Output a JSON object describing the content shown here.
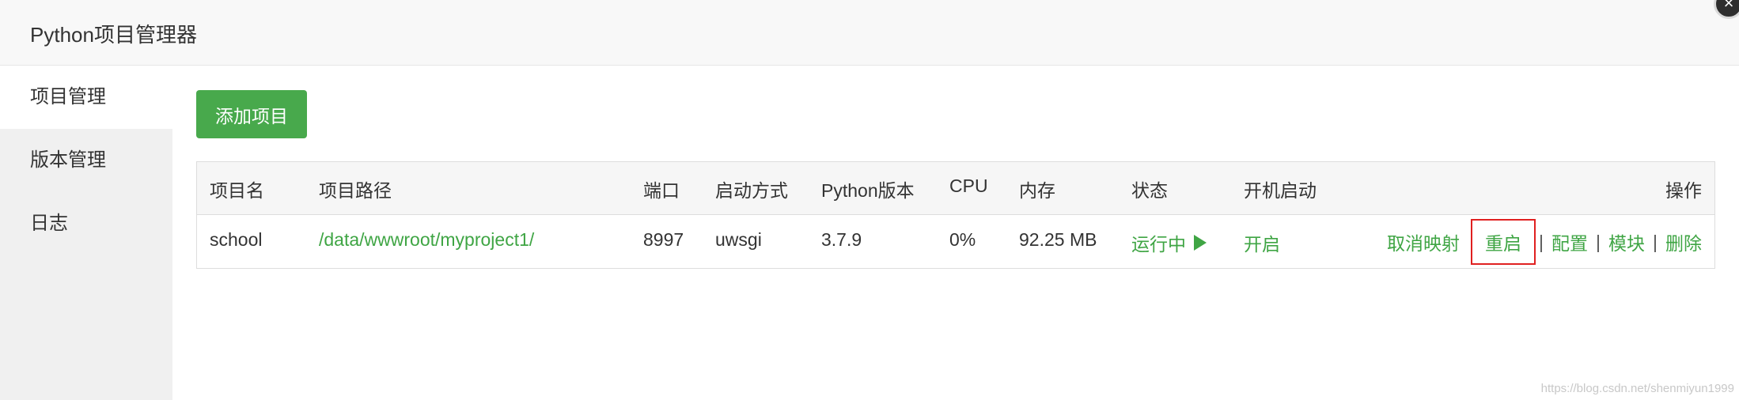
{
  "window": {
    "title": "Python项目管理器",
    "close_icon": "close-icon",
    "close_glyph": "×"
  },
  "sidebar": {
    "items": [
      {
        "label": "项目管理",
        "active": true
      },
      {
        "label": "版本管理",
        "active": false
      },
      {
        "label": "日志",
        "active": false
      }
    ]
  },
  "toolbar": {
    "add_label": "添加项目"
  },
  "table": {
    "headers": {
      "name": "项目名",
      "path": "项目路径",
      "port": "端口",
      "start_mode": "启动方式",
      "python_version": "Python版本",
      "cpu": "CPU",
      "memory": "内存",
      "status": "状态",
      "autostart": "开机启动",
      "actions": "操作"
    },
    "rows": [
      {
        "name": "school",
        "path": "/data/wwwroot/myproject1/",
        "port": "8997",
        "start_mode": "uwsgi",
        "python_version": "3.7.9",
        "cpu": "0%",
        "memory": "92.25 MB",
        "status": "运行中",
        "status_icon": "play-icon",
        "autostart": "开启",
        "actions": {
          "unmap": "取消映射",
          "restart": "重启",
          "config": "配置",
          "modules": "模块",
          "delete": "删除",
          "separator": "|"
        }
      }
    ]
  },
  "colors": {
    "accent_green": "#48a94c",
    "link_green": "#3fa544",
    "highlight_red": "#e02020"
  },
  "watermark": "https://blog.csdn.net/shenmiyun1999"
}
